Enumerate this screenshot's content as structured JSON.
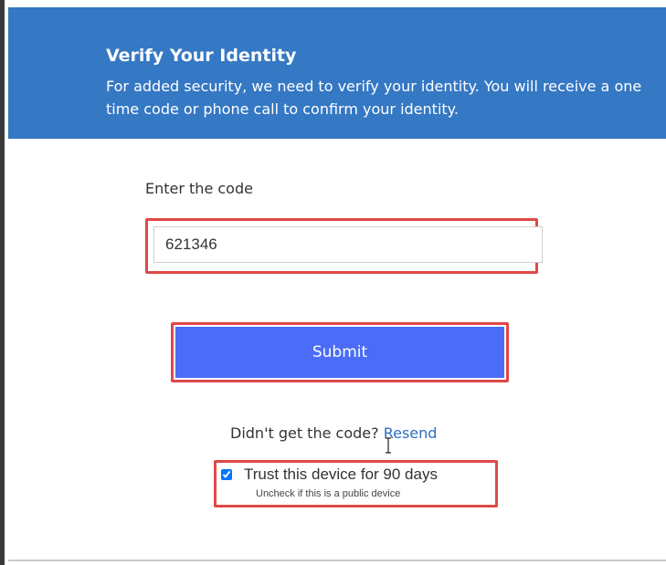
{
  "header": {
    "title": "Verify Your Identity",
    "subtitle": "For added security, we need to verify your identity. You will receive a one time code or phone call to confirm your identity."
  },
  "code": {
    "label": "Enter the code",
    "value": "621346"
  },
  "submit": {
    "label": "Submit"
  },
  "resend": {
    "prompt": "Didn't get the code?",
    "link_label": "Resend"
  },
  "trust": {
    "label": "Trust this device for 90 days",
    "hint": "Uncheck if this is a public device",
    "checked": true
  },
  "colors": {
    "header_bg": "#3578c4",
    "button_bg": "#4a6cf7",
    "highlight_border": "#e04848",
    "link": "#2e6fc2"
  }
}
